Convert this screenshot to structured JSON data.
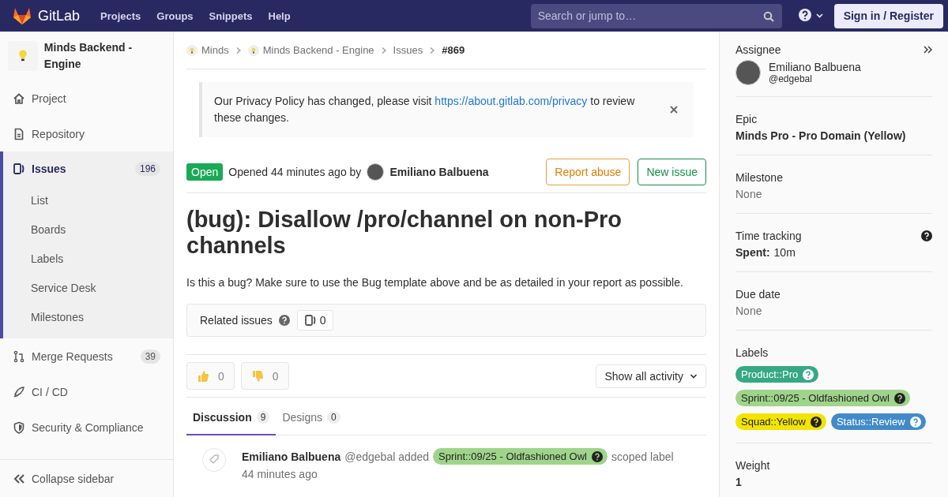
{
  "header": {
    "brand": "GitLab",
    "nav": [
      {
        "label": "Projects"
      },
      {
        "label": "Groups"
      },
      {
        "label": "Snippets"
      },
      {
        "label": "Help"
      }
    ],
    "search": {
      "placeholder": "Search or jump to…"
    },
    "sign_in": "Sign in / Register"
  },
  "sidebar": {
    "project_name": "Minds Backend - Engine",
    "items": [
      {
        "label": "Project",
        "selected": false
      },
      {
        "label": "Repository",
        "selected": false
      },
      {
        "label": "Issues",
        "count": "196",
        "selected": true,
        "children": [
          {
            "label": "List"
          },
          {
            "label": "Boards"
          },
          {
            "label": "Labels"
          },
          {
            "label": "Service Desk"
          },
          {
            "label": "Milestones"
          }
        ]
      },
      {
        "label": "Merge Requests",
        "count": "39",
        "selected": false
      },
      {
        "label": "CI / CD",
        "selected": false
      },
      {
        "label": "Security & Compliance",
        "selected": false
      }
    ],
    "collapse": "Collapse sidebar"
  },
  "breadcrumbs": [
    {
      "label": "Minds",
      "kind": "avatar",
      "current": false
    },
    {
      "label": "Minds Backend - Engine",
      "kind": "avatar",
      "current": false
    },
    {
      "label": "Issues",
      "kind": "plain",
      "current": false
    },
    {
      "label": "#869",
      "kind": "plain",
      "current": true
    }
  ],
  "banner": {
    "before": "Our Privacy Policy has changed, please visit ",
    "link": "https://about.gitlab.com/privacy",
    "after": " to review these changes."
  },
  "issue": {
    "status": "Open",
    "opened": "Opened 44 minutes ago by",
    "author": "Emiliano Balbuena",
    "buttons": [
      {
        "label": "Report abuse",
        "kind": "warning"
      },
      {
        "label": "New issue",
        "kind": "success"
      }
    ],
    "title": "(bug): Disallow /pro/channel on non-Pro channels",
    "description": "Is this a bug? Make sure to use the Bug template above and be as detailed in your report as possible.",
    "related": {
      "label": "Related issues",
      "count": "0"
    },
    "reactions": [
      {
        "kind": "thumbs_up",
        "count": "0"
      },
      {
        "kind": "thumbs_down",
        "count": "0"
      }
    ],
    "activity_filter": "Show all activity",
    "tabs": [
      {
        "label": "Discussion",
        "count": "9",
        "selected": true
      },
      {
        "label": "Designs",
        "count": "0",
        "selected": false
      }
    ],
    "note": {
      "author": "Emiliano Balbuena",
      "action": "@edgebal added",
      "label": {
        "text": "Sprint::09/25 - Oldfashioned Owl",
        "color": "#9fd48b"
      },
      "suffix": "scoped label",
      "time": "44 minutes ago"
    }
  },
  "right_sidebar": {
    "sections": [
      {
        "kind": "assignee",
        "title": "Assignee",
        "name": "Emiliano Balbuena",
        "handle": "@edgebal"
      },
      {
        "kind": "bold",
        "title": "Epic",
        "value": "Minds Pro - Pro Domain (Yellow)"
      },
      {
        "kind": "muted",
        "title": "Milestone",
        "value": "None"
      },
      {
        "kind": "time",
        "title": "Time tracking",
        "key": "Spent:",
        "value": "10m"
      },
      {
        "kind": "muted",
        "title": "Due date",
        "value": "None"
      },
      {
        "kind": "labels",
        "title": "Labels",
        "labels": [
          {
            "text": "Product::Pro",
            "color": "#36a883"
          },
          {
            "text": "Sprint::09/25 - Oldfashioned Owl",
            "color": "#9fd48b"
          },
          {
            "text": "Squad::Yellow",
            "color": "#f3e400"
          },
          {
            "text": "Status::Review",
            "color": "#428bca"
          }
        ]
      },
      {
        "kind": "bold",
        "title": "Weight",
        "value": "1"
      }
    ]
  }
}
